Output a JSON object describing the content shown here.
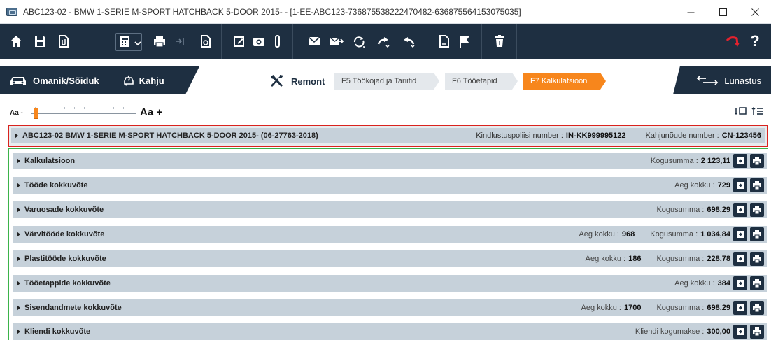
{
  "window": {
    "title": "ABC123-02 - BMW 1-SERIE M-SPORT HATCHBACK 5-DOOR 2015- - [1-EE-ABC123-736875538222470482-636875564153075035]",
    "minimize": "–",
    "maximize": "☐",
    "close": "✕"
  },
  "toolbar": {
    "icons": [
      "home-icon",
      "save-icon",
      "attach-file-icon",
      "calculator-dropdown-icon",
      "print-icon",
      "collapse-icon",
      "refresh-doc-icon",
      "edit-icon",
      "camera-icon",
      "paperclip-icon",
      "mail-icon",
      "mail-forward-icon",
      "sync-icon",
      "redo-icon",
      "undo-icon",
      "document-icon",
      "flag-icon",
      "trash-icon",
      "back-red-icon",
      "help-icon"
    ],
    "help_label": "?"
  },
  "tabs": {
    "owner_label": "Omanik/Sõiduk",
    "damage_label": "Kahju",
    "remont_label": "Remont",
    "steps": [
      {
        "label": "F5  Töökojad ja Tariifid",
        "state": "inactive"
      },
      {
        "label": "F6  Tööetapid",
        "state": "inactive"
      },
      {
        "label": "F7  Kalkulatsioon",
        "state": "active"
      }
    ],
    "lunastus_label": "Lunastus"
  },
  "font_size": {
    "minus_label": "Aa -",
    "plus_label": "Aa +",
    "level": 0.02
  },
  "vehicle": {
    "label": "ABC123-02   BMW 1-SERIE M-SPORT HATCHBACK 5-DOOR 2015- (06-27763-2018)",
    "policy_label": "Kindlustuspoliisi number :",
    "policy_value": "IN-KK999995122",
    "claim_label": "Kahjunõude number :",
    "claim_value": "CN-123456"
  },
  "rows": [
    {
      "title": "Kalkulatsioon",
      "fields": [
        {
          "label": "Kogusumma :",
          "value": "2 123,11"
        }
      ]
    },
    {
      "title": "Tööde kokkuvõte",
      "fields": [
        {
          "label": "Aeg kokku :",
          "value": "729"
        }
      ]
    },
    {
      "title": "Varuosade kokkuvõte",
      "fields": [
        {
          "label": "Kogusumma :",
          "value": "698,29"
        }
      ]
    },
    {
      "title": "Värvitööde kokkuvõte",
      "fields": [
        {
          "label": "Aeg kokku :",
          "value": "968"
        },
        {
          "label": "Kogusumma :",
          "value": "1 034,84"
        }
      ]
    },
    {
      "title": "Plastitööde kokkuvõte",
      "fields": [
        {
          "label": "Aeg kokku :",
          "value": "186"
        },
        {
          "label": "Kogusumma :",
          "value": "228,78"
        }
      ]
    },
    {
      "title": "Tööetappide kokkuvõte",
      "fields": [
        {
          "label": "Aeg kokku :",
          "value": "384"
        }
      ]
    },
    {
      "title": "Sisendandmete kokkuvõte",
      "fields": [
        {
          "label": "Aeg kokku :",
          "value": "1700"
        },
        {
          "label": "Kogusumma :",
          "value": "698,29"
        }
      ]
    },
    {
      "title": "Kliendi kokkuvõte",
      "fields": [
        {
          "label": "Kliendi kogumakse :",
          "value": "300,00"
        }
      ]
    }
  ],
  "colors": {
    "toolbar_bg": "#1e2f41",
    "active_step": "#f7861c",
    "row_bg": "#c6d1da",
    "header_border": "#d9231e",
    "green_line": "#3bb34a"
  }
}
